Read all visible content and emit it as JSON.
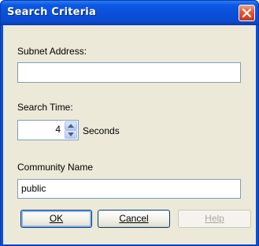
{
  "window": {
    "title": "Search Criteria"
  },
  "form": {
    "subnet_label": "Subnet Address:",
    "subnet_value": "",
    "search_time_label": "Search Time:",
    "search_time_value": "4",
    "seconds_label": "Seconds",
    "community_label": "Community Name",
    "community_value": "public"
  },
  "buttons": {
    "ok": "OK",
    "cancel": "Cancel",
    "help": "Help"
  },
  "colors": {
    "titlebar": "#0a4fd8",
    "close_button": "#d8482a",
    "client_background": "#ece9d8",
    "input_border": "#7f9db9",
    "disabled_text": "#aca899"
  },
  "icons": {
    "close": "close-icon",
    "spin_up": "arrow-up-icon",
    "spin_down": "arrow-down-icon"
  }
}
